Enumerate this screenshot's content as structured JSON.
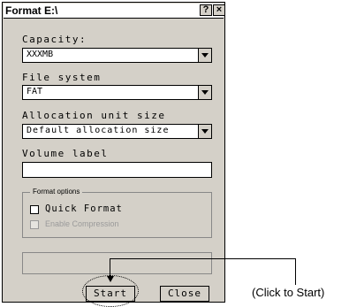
{
  "window": {
    "title": "Format E:\\",
    "help_label": "?",
    "close_label": "×"
  },
  "capacity": {
    "label": "Capacity:",
    "value": "XXXMB"
  },
  "file_system": {
    "label": "File system",
    "value": "FAT"
  },
  "allocation": {
    "label": "Allocation unit size",
    "value": "Default allocation size"
  },
  "volume": {
    "label": "Volume label",
    "value": ""
  },
  "format_options": {
    "label": "Format options",
    "quick_format": "Quick Format",
    "enable_compression": "Enable Compression"
  },
  "buttons": {
    "start": "Start",
    "close": "Close"
  },
  "callout": {
    "text": "(Click to Start)"
  }
}
